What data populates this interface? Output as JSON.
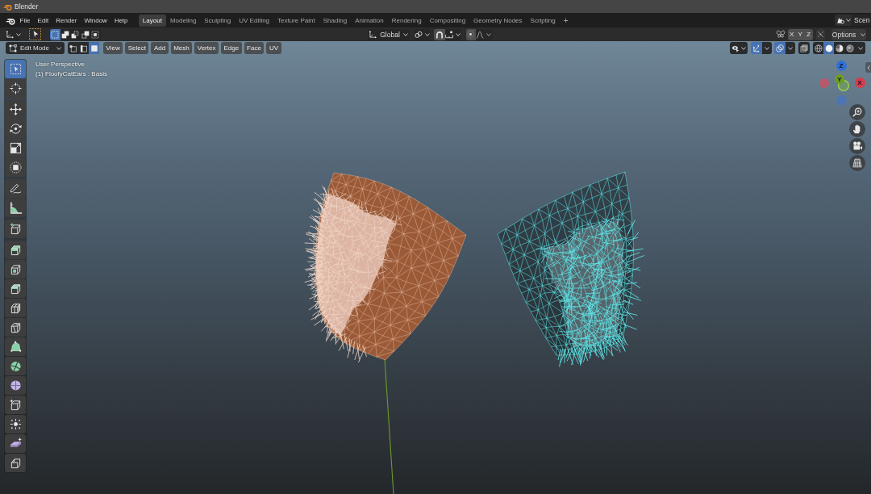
{
  "window": {
    "title": "Blender"
  },
  "menu_bar": {
    "items": [
      "File",
      "Edit",
      "Render",
      "Window",
      "Help"
    ]
  },
  "workspace_tabs": [
    {
      "label": "Layout",
      "selected": true
    },
    {
      "label": "Modeling",
      "selected": false
    },
    {
      "label": "Sculpting",
      "selected": false
    },
    {
      "label": "UV Editing",
      "selected": false
    },
    {
      "label": "Texture Paint",
      "selected": false
    },
    {
      "label": "Shading",
      "selected": false
    },
    {
      "label": "Animation",
      "selected": false
    },
    {
      "label": "Rendering",
      "selected": false
    },
    {
      "label": "Compositing",
      "selected": false
    },
    {
      "label": "Geometry Nodes",
      "selected": false
    },
    {
      "label": "Scripting",
      "selected": false
    }
  ],
  "add_workspace": "+",
  "scene_selector": {
    "name": "Scen"
  },
  "tool_header": {
    "selection_modes": [
      {
        "kind": "set",
        "selected": true
      },
      {
        "kind": "extend",
        "selected": false
      },
      {
        "kind": "subtract",
        "selected": false
      },
      {
        "kind": "invert",
        "selected": false
      },
      {
        "kind": "intersect",
        "selected": false
      }
    ],
    "orientation": "Global",
    "snap": {
      "on": false
    },
    "proportional_editing": {
      "on": false
    },
    "mirror_axes": [
      {
        "label": "X",
        "on": false
      },
      {
        "label": "Y",
        "on": false
      },
      {
        "label": "Z",
        "on": false
      }
    ],
    "auto_merge": {
      "on": false
    },
    "options": "Options"
  },
  "viewport_header": {
    "mode": "Edit Mode",
    "select_modes": [
      {
        "kind": "vertex",
        "selected": false
      },
      {
        "kind": "edge",
        "selected": false
      },
      {
        "kind": "face",
        "selected": true
      }
    ],
    "menus": [
      "View",
      "Select",
      "Add",
      "Mesh",
      "Vertex",
      "Edge",
      "Face",
      "UV"
    ],
    "gizmos": {
      "on": true
    },
    "overlays": {
      "on": true
    },
    "xray": {
      "on": false
    },
    "shading_modes": [
      {
        "kind": "wireframe",
        "selected": false
      },
      {
        "kind": "solid",
        "selected": true
      },
      {
        "kind": "material",
        "selected": false
      },
      {
        "kind": "rendered",
        "selected": false
      }
    ]
  },
  "viewport": {
    "overlay_text": [
      "User Perspective",
      "(1) FloofyCatEars : Basis"
    ]
  },
  "toolbar": {
    "tool_groups": [
      [
        {
          "kind": "select",
          "selected": true
        },
        {
          "kind": "cursor",
          "selected": false
        }
      ],
      [
        {
          "kind": "move",
          "selected": false
        },
        {
          "kind": "rotate",
          "selected": false
        },
        {
          "kind": "scale",
          "selected": false
        },
        {
          "kind": "transform",
          "selected": false
        }
      ],
      [
        {
          "kind": "annotate",
          "selected": false
        },
        {
          "kind": "measure",
          "selected": false
        }
      ],
      [
        {
          "kind": "add_cube",
          "selected": false
        }
      ],
      [
        {
          "kind": "extrude",
          "selected": false
        },
        {
          "kind": "inset",
          "selected": false
        },
        {
          "kind": "bevel",
          "selected": false
        },
        {
          "kind": "loop_cut",
          "selected": false
        },
        {
          "kind": "knife",
          "selected": false
        },
        {
          "kind": "poly_build",
          "selected": false
        },
        {
          "kind": "spin",
          "selected": false
        },
        {
          "kind": "smooth",
          "selected": false
        },
        {
          "kind": "slide",
          "selected": false
        },
        {
          "kind": "shrink",
          "selected": false
        },
        {
          "kind": "shear",
          "selected": false
        },
        {
          "kind": "rip",
          "selected": false
        }
      ]
    ]
  },
  "navigation_gizmo": {
    "axes": [
      {
        "label": "Z",
        "color": "#2f6fd8"
      },
      {
        "label": "Y",
        "color": "#6e9b27"
      },
      {
        "label": "X",
        "color": "#d63c4d"
      }
    ]
  }
}
